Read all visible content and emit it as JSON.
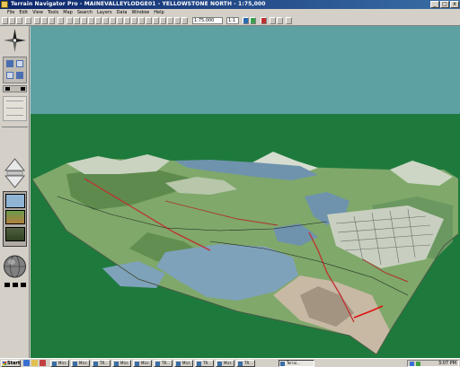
{
  "window": {
    "title": "Terrain Navigator Pro - MAINEVALLEYLODGE01 - YELLOWSTONE NORTH - 1:75,000",
    "minimize_label": "_",
    "maximize_label": "□",
    "close_label": "x"
  },
  "menu": {
    "items": [
      "File",
      "Edit",
      "View",
      "Tools",
      "Map",
      "Search",
      "Layers",
      "Data",
      "Window",
      "Help"
    ]
  },
  "toolbar": {
    "scale_value": "1:75,000",
    "zoom_value": "1:1"
  },
  "taskbar": {
    "start_label": "Start",
    "tasks": [
      "Micr...",
      "Micr...",
      "TR...",
      "Micr...",
      "Micr...",
      "TR...",
      "Micr...",
      "TR...",
      "Micr...",
      "TR..."
    ],
    "active_task": "Terrai...",
    "clock": "3:07 PM"
  },
  "colors": {
    "sky": "#5da1a3",
    "ground": "#1e7a3c",
    "titlebar": "#0a246a",
    "water": "#6f93ad",
    "trail": "#c03030"
  }
}
